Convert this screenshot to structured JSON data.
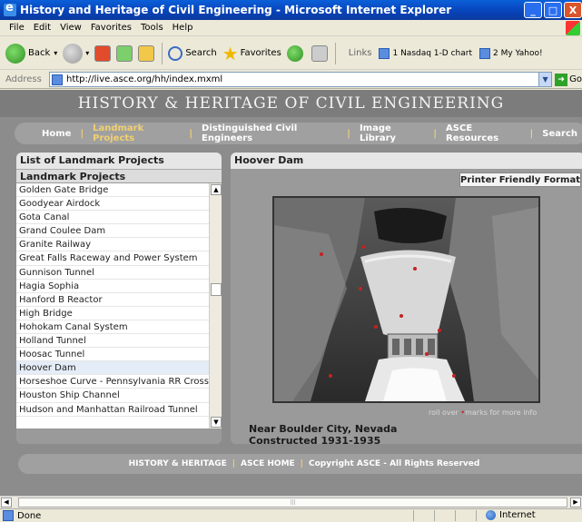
{
  "window": {
    "title": "History and Heritage of Civil Engineering - Microsoft Internet Explorer",
    "minimize": "_",
    "maximize": "□",
    "close": "X"
  },
  "menu": [
    "File",
    "Edit",
    "View",
    "Favorites",
    "Tools",
    "Help"
  ],
  "toolbar": {
    "back": "Back",
    "search": "Search",
    "favorites": "Favorites",
    "links_label": "Links",
    "link1": "1 Nasdaq 1-D chart",
    "link2": "2 My Yahoo!"
  },
  "address": {
    "label": "Address",
    "url": "http://live.asce.org/hh/index.mxml",
    "go": "Go"
  },
  "site": {
    "banner": "HISTORY & HERITAGE OF CIVIL ENGINEERING",
    "nav": [
      "Home",
      "Landmark Projects",
      "Distinguished Civil Engineers",
      "Image Library",
      "ASCE Resources",
      "Search"
    ],
    "nav_sep": "|"
  },
  "left_panel": {
    "title": "List of Landmark Projects",
    "column_header": "Landmark Projects",
    "items": [
      "Golden Gate Bridge",
      "Goodyear Airdock",
      "Gota Canal",
      "Grand Coulee Dam",
      "Granite Railway",
      "Great Falls Raceway and Power System",
      "Gunnison Tunnel",
      "Hagia Sophia",
      "Hanford B Reactor",
      "High Bridge",
      "Hohokam Canal System",
      "Holland Tunnel",
      "Hoosac Tunnel",
      "Hoover Dam",
      "Horseshoe Curve - Pennsylvania RR Crossing A",
      "Houston Ship Channel",
      "Hudson and Manhattan Railroad Tunnel"
    ],
    "selected_index": 13
  },
  "right_panel": {
    "title": "Hoover Dam",
    "printer_button": "Printer Friendly Format",
    "rollover_prefix": "roll over",
    "rollover_dot": "•",
    "rollover_suffix": "marks for more info",
    "caption_line1": "Near Boulder City, Nevada",
    "caption_line2": "Constructed 1931-1935"
  },
  "footer": {
    "link1": "HISTORY & HERITAGE",
    "link2": "ASCE HOME",
    "copyright": "Copyright ASCE - All Rights Reserved",
    "sep": "|"
  },
  "statusbar": {
    "status": "Done",
    "zone": "Internet"
  },
  "colors": {
    "page_bg": "#8c8c8c",
    "nav_active": "#f0d070",
    "marker": "#c62020"
  }
}
